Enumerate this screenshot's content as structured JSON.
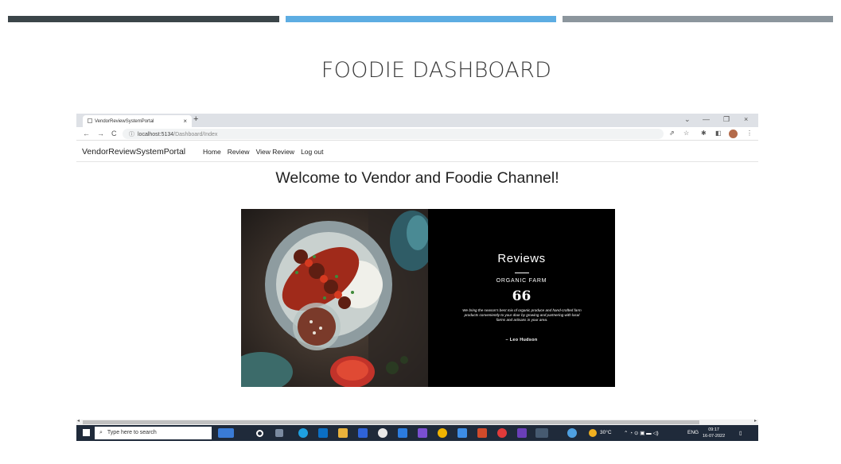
{
  "slide": {
    "title": "FOODIE DASHBOARD"
  },
  "browser": {
    "tab_title": "VendorReviewSystemPortal",
    "tab_close": "×",
    "new_tab": "+",
    "url_host": "localhost:5134",
    "url_path": "/Dashboard/Index",
    "window_controls": {
      "chevron": "⌄",
      "minimize": "—",
      "restore": "❐",
      "close": "×"
    }
  },
  "app": {
    "brand": "VendorReviewSystemPortal",
    "nav": [
      "Home",
      "Review",
      "View Review",
      "Log out"
    ],
    "welcome": "Welcome to Vendor and Foodie Channel!"
  },
  "review_card": {
    "title": "Reviews",
    "subtitle": "ORGANIC FARM",
    "quote_mark": "66",
    "text": "We bring the season's best mix of organic produce and hand-crafted farm products conveniently to your door by growing and partnering with local farms and artisans in your area.",
    "author": "– Leo Hudson"
  },
  "taskbar": {
    "search_placeholder": "Type here to search",
    "weather": "30°C",
    "language": "ENG",
    "time": "09:17",
    "date": "16-07-2022"
  },
  "colors": {
    "bar_dark": "#3b4549",
    "bar_blue": "#5dade2",
    "bar_gray": "#8c969d",
    "taskbar": "#1f2a3a"
  }
}
